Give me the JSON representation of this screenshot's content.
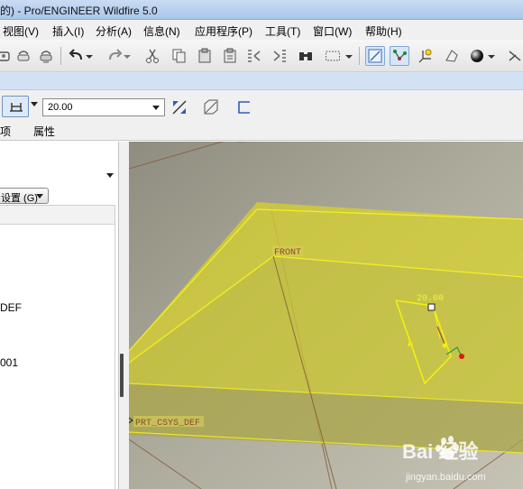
{
  "window": {
    "title": "的) - Pro/ENGINEER Wildfire 5.0"
  },
  "menu": {
    "items": [
      {
        "label": "视图(V)",
        "key": "view"
      },
      {
        "label": "插入(I)",
        "key": "insert"
      },
      {
        "label": "分析(A)",
        "key": "analysis"
      },
      {
        "label": "信息(N)",
        "key": "info"
      },
      {
        "label": "应用程序(P)",
        "key": "applications"
      },
      {
        "label": "工具(T)",
        "key": "tools"
      },
      {
        "label": "窗口(W)",
        "key": "window"
      },
      {
        "label": "帮助(H)",
        "key": "help"
      }
    ]
  },
  "toolbar": {
    "icons": [
      "save-copy-icon",
      "print-icon",
      "send-icon",
      "undo-icon",
      "redo-icon",
      "cut-icon",
      "copy-icon",
      "paste-icon",
      "paste-special-icon",
      "regenerate-icon",
      "find-icon",
      "select-box-icon",
      "datum-display-icon",
      "datum-points-icon",
      "coord-sys-icon",
      "orient-icon",
      "shading-icon",
      "more-icon"
    ]
  },
  "dashboard": {
    "dimension_value": "20.00",
    "tab_options": "项",
    "tab_properties": "属性"
  },
  "model_tree": {
    "settings_label": "设置 (G)",
    "items": [
      {
        "label": "DEF"
      },
      {
        "label": "001"
      }
    ]
  },
  "viewport": {
    "datum_front_label": "FRONT",
    "csys_label": "PRT_CSYS_DEF",
    "sketch_dim_label": "20.00",
    "colors": {
      "background": "#a8a797",
      "plane_fill": "#c9c52a",
      "plane_edge": "#f0ec1e",
      "sketch": "#f5ef10"
    }
  },
  "watermark": {
    "brand": "Bai 经验",
    "url": "jingyan.baidu.com"
  }
}
